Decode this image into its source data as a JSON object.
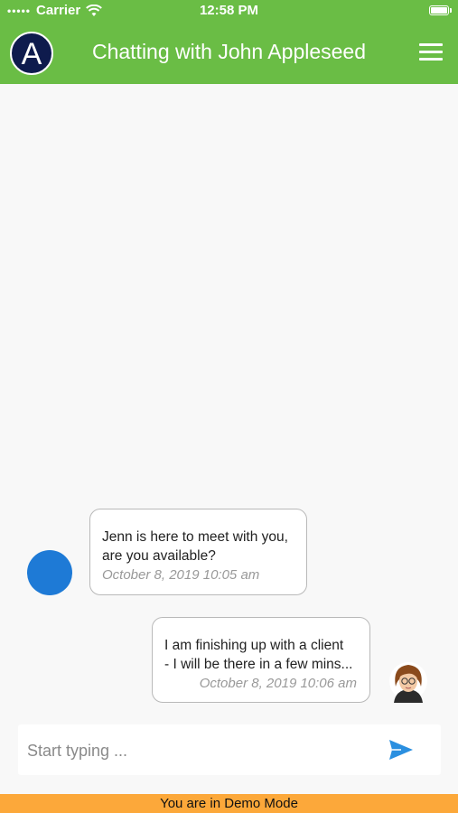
{
  "status_bar": {
    "signal": "•••••",
    "carrier": "Carrier",
    "time": "12:58 PM"
  },
  "header": {
    "title": "Chatting with John Appleseed",
    "logo_letter": "A"
  },
  "messages": [
    {
      "text_line1": "Jenn is here to meet with you,",
      "text_line2": "are you available?",
      "timestamp": "October 8, 2019 10:05 am"
    },
    {
      "text_line1": "I am finishing up with a client",
      "text_line2": "- I will be there in a few mins...",
      "timestamp": "October 8, 2019 10:06 am"
    }
  ],
  "composer": {
    "placeholder": "Start typing ..."
  },
  "demo_banner": "You are in Demo Mode",
  "colors": {
    "header": "#6abd45",
    "avatar": "#1e7ad6",
    "send": "#2a8fe0",
    "banner": "#fca83a"
  }
}
